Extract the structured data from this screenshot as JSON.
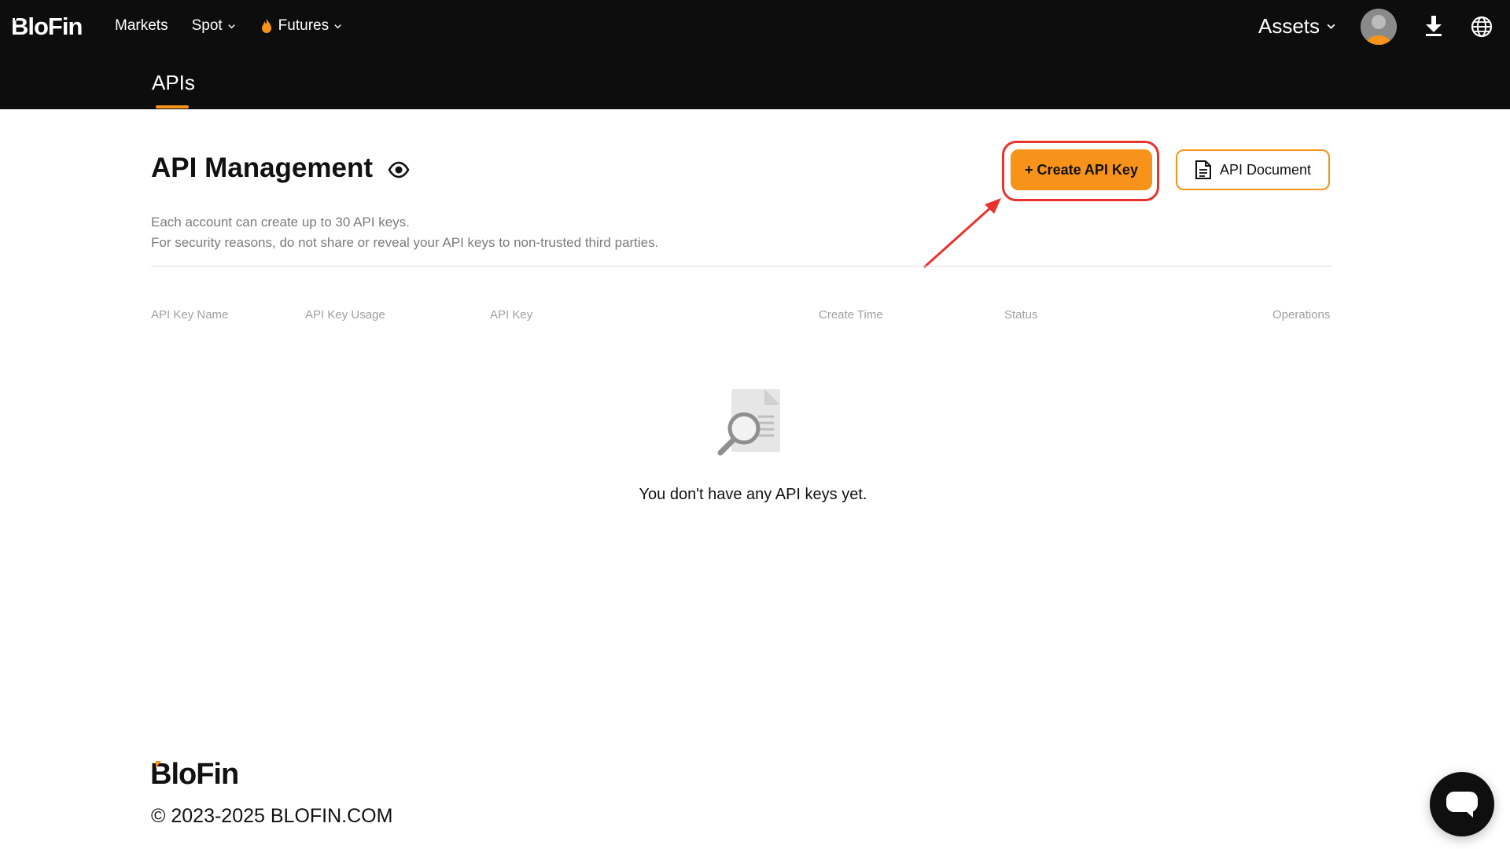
{
  "brand": {
    "name": "BloFin",
    "accent": "#f7931a",
    "nav_bg": "#0d0d0d"
  },
  "nav": {
    "links": [
      {
        "label": "Markets",
        "icon": null,
        "dropdown": false
      },
      {
        "label": "Spot",
        "icon": null,
        "dropdown": true
      },
      {
        "label": "Futures",
        "icon": "flame-icon",
        "dropdown": true
      }
    ],
    "assets_label": "Assets",
    "right_icons": [
      "avatar",
      "download-icon",
      "globe-icon"
    ]
  },
  "subnav": {
    "active_tab": "APIs"
  },
  "main": {
    "title": "API Management",
    "title_icon": "eye-icon",
    "create_button_label": "+ Create API Key",
    "doc_button_label": "API Document",
    "description_lines": [
      "Each account can create up to 30 API keys.",
      "For security reasons, do not share or reveal your API keys to non-trusted third parties."
    ],
    "table": {
      "columns": [
        "API Key Name",
        "API Key Usage",
        "API Key",
        "Create Time",
        "Status",
        "Operations"
      ],
      "rows": []
    },
    "empty_message": "You don't have any API keys yet."
  },
  "annotation": {
    "highlight_color": "#e8332e",
    "target": "create-api-key-button"
  },
  "footer": {
    "logo": "BloFin",
    "copyright": "© 2023-2025 BLOFIN.COM",
    "chat_icon": "chat-icon"
  }
}
